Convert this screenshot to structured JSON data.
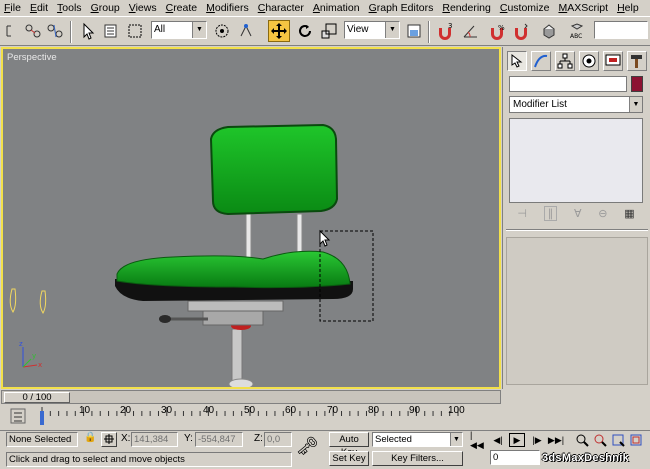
{
  "menu": [
    "File",
    "Edit",
    "Tools",
    "Group",
    "Views",
    "Create",
    "Modifiers",
    "Character",
    "Animation",
    "Graph Editors",
    "Rendering",
    "Customize",
    "MAXScript",
    "Help"
  ],
  "toolbar": {
    "selection_filter": "All",
    "coord_system": "View",
    "named_selection": ""
  },
  "viewport": {
    "label": "Perspective"
  },
  "command_panel": {
    "object_name": "",
    "object_color": "#8c1232",
    "modifier_list": "Modifier List"
  },
  "timeline": {
    "frame_display": "0 / 100",
    "ticks": [
      "10",
      "20",
      "30",
      "40",
      "50",
      "60",
      "70",
      "80",
      "90",
      "100"
    ]
  },
  "status": {
    "selection": "None Selected",
    "prompt": "Click and drag to select and move objects",
    "x_label": "X:",
    "x_value": "141,384",
    "y_label": "Y:",
    "y_value": "-554,847",
    "z_label": "Z:",
    "z_value": "0,0",
    "auto_key": "Auto Key",
    "set_key": "Set Key",
    "key_mode": "Selected",
    "key_filters": "Key Filters...",
    "current_frame": "0"
  },
  "watermark": "3dsMaxDeshnik",
  "colors": {
    "viewport_bg": "#808284",
    "active_border": "#f2e04a",
    "chair_green": "#0fa21a",
    "highlight_button": "#f5c542"
  }
}
